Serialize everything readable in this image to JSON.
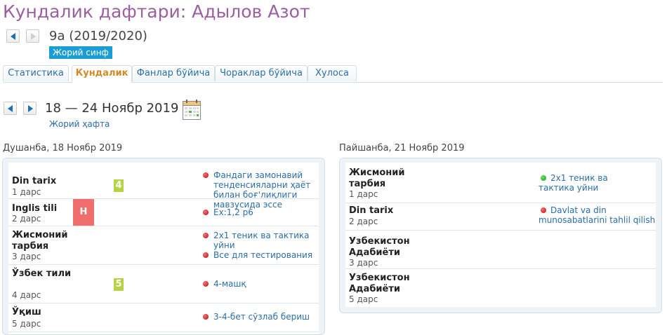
{
  "page": {
    "title": "Кундалик дафтари: Адылов Азот"
  },
  "class_info": {
    "name": "9а (2019/2020)",
    "badge": "Жорий синф"
  },
  "tabs": [
    {
      "label": "Статистика"
    },
    {
      "label": "Кундалик"
    },
    {
      "label": "Фанлар бўйича"
    },
    {
      "label": "Чораклар бўйича"
    },
    {
      "label": "Хулоса"
    }
  ],
  "week": {
    "range": "18 — 24 Ноябр 2019",
    "current": "Жорий ҳафта"
  },
  "colors": {
    "accent": "#1a9dd3",
    "title": "#9b5fa0",
    "link": "#2a6ea7",
    "grade_good": "#b6d345",
    "absent": "#ef6e6e"
  },
  "days": [
    {
      "title": "Душанба, 18 Ноябр 2019",
      "lessons": [
        {
          "subject": "Din tarix",
          "lesson": "1 дарс",
          "grade": "4",
          "homework": [
            {
              "text": "Фандаги замонавий тенденсияларни ҳаёт билан боғ'лиқлиги мавзусида эссе",
              "status": "red"
            }
          ]
        },
        {
          "subject": "Inglis tili",
          "lesson": "2 дарс",
          "grade": "Н",
          "homework": [
            {
              "text": "Ex:1,2 p6",
              "status": "red"
            }
          ]
        },
        {
          "subject": "Жисмоний тарбия",
          "lesson": "3 дарс",
          "grade": "",
          "homework": [
            {
              "text": "2х1 теник ва тактика уйни",
              "status": "red"
            },
            {
              "text": "Все для тестирования",
              "status": "red"
            }
          ]
        },
        {
          "subject": "Ўзбек тили",
          "lesson": "4 дарс",
          "grade": "5",
          "homework": [
            {
              "text": "4-машқ",
              "status": "red"
            }
          ]
        },
        {
          "subject": "Ўқиш",
          "lesson": "5 дарс",
          "grade": "",
          "homework": [
            {
              "text": "3-4-бет сўзлаб бериш",
              "status": "red"
            }
          ]
        }
      ]
    },
    {
      "title": "Пайшанба, 21 Ноябр 2019",
      "lessons": [
        {
          "subject": "Жисмоний тарбия",
          "lesson": "1 дарс",
          "grade": "",
          "homework": [
            {
              "text": "2х1 теник ва тактика уйни",
              "status": "green"
            }
          ]
        },
        {
          "subject": "Din tarix",
          "lesson": "2 дарс",
          "grade": "",
          "homework": [
            {
              "text": "Davlat va din munosabatlarini tahlil qilish",
              "status": "red"
            }
          ]
        },
        {
          "subject": "Узбекистон Адабиёти",
          "lesson": "3 дарс",
          "grade": "",
          "homework": []
        },
        {
          "subject": "Узбекистон Адабиёти",
          "lesson": "5 дарс",
          "grade": "",
          "homework": []
        }
      ]
    }
  ]
}
